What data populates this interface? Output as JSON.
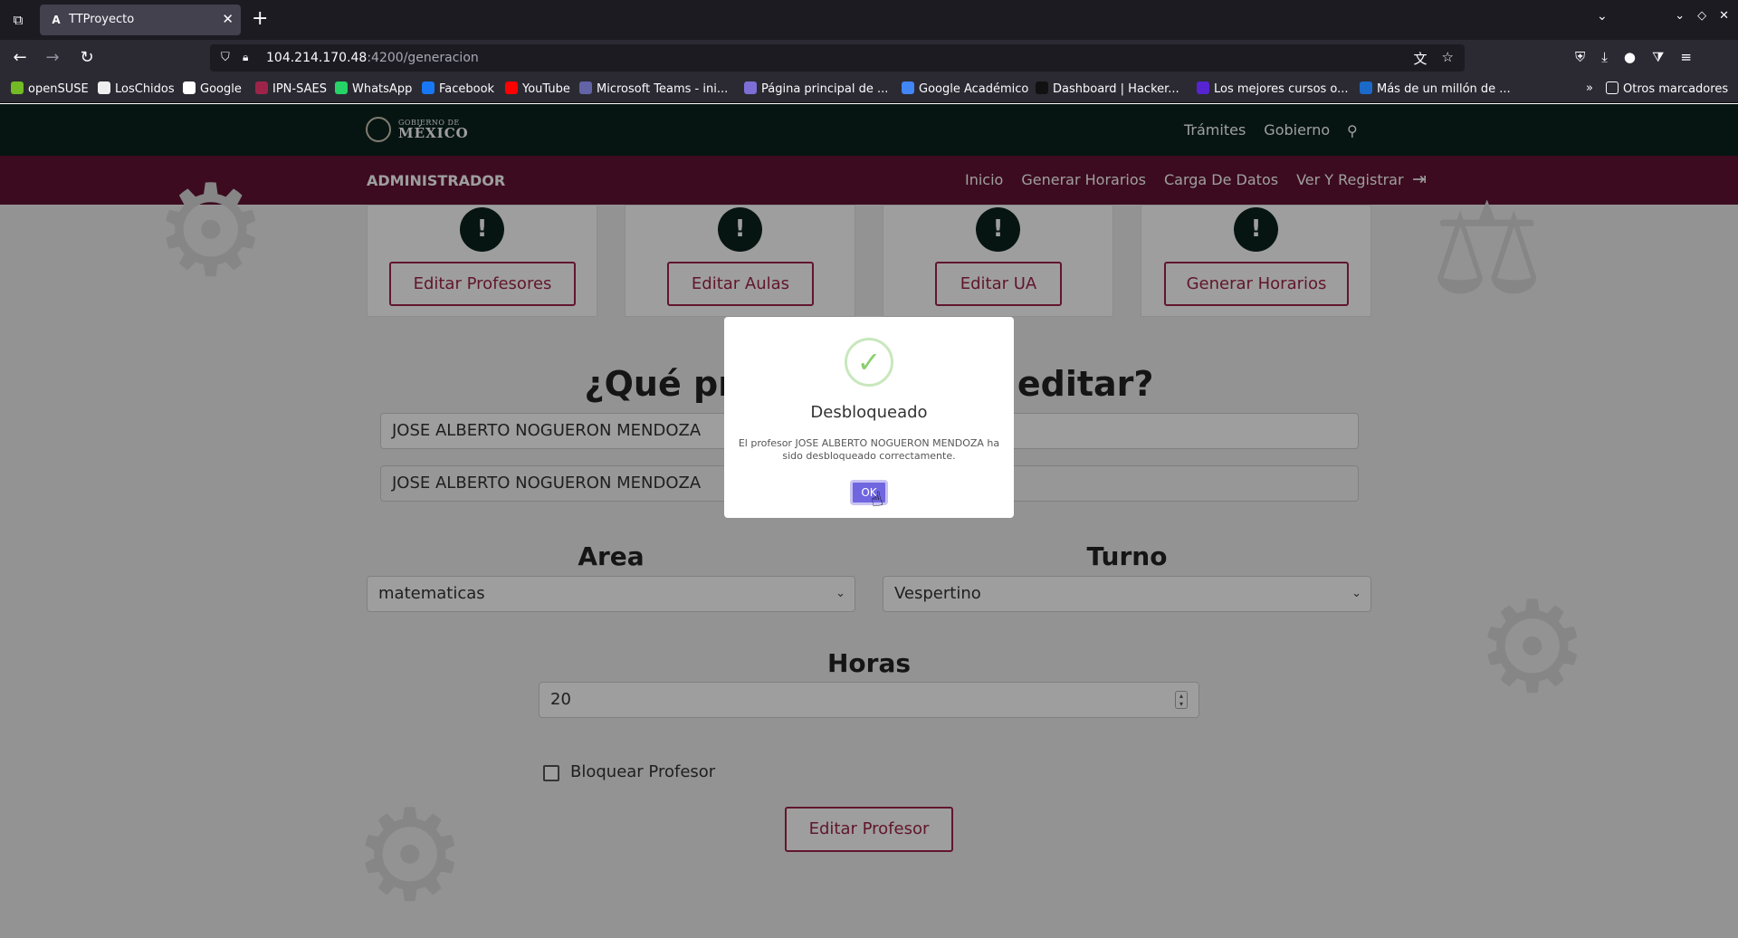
{
  "browser": {
    "tab_title": "TTProyecto",
    "tab_favicon": "A",
    "url_host": "104.214.170.48",
    "url_path": ":4200/generacion",
    "bookmarks": [
      {
        "label": "openSUSE",
        "color": "#73ba25"
      },
      {
        "label": "LosChidos",
        "color": "#eeeeee"
      },
      {
        "label": "Google",
        "color": "#ffffff"
      },
      {
        "label": "IPN-SAES",
        "color": "#9d2449"
      },
      {
        "label": "WhatsApp",
        "color": "#25d366"
      },
      {
        "label": "Facebook",
        "color": "#1877f2"
      },
      {
        "label": "YouTube",
        "color": "#ff0000"
      },
      {
        "label": "Microsoft Teams - ini...",
        "color": "#6264a7"
      },
      {
        "label": "Página principal de ...",
        "color": "#7b6fd6"
      },
      {
        "label": "Google Académico",
        "color": "#4285f4"
      },
      {
        "label": "Dashboard | Hacker...",
        "color": "#111111"
      },
      {
        "label": "Los mejores cursos o...",
        "color": "#5624d0"
      },
      {
        "label": "Más de un millón de ...",
        "color": "#1b6ac9"
      }
    ],
    "other_bookmarks": "Otros marcadores"
  },
  "gov_header": {
    "logo_line1": "GOBIERNO DE",
    "logo_line2": "MÉXICO",
    "links": [
      "Trámites",
      "Gobierno"
    ]
  },
  "admin_bar": {
    "title": "ADMINISTRADOR",
    "links": [
      "Inicio",
      "Generar Horarios",
      "Carga De Datos",
      "Ver Y Registrar"
    ]
  },
  "cards": [
    "Editar Profesores",
    "Editar Aulas",
    "Editar UA",
    "Generar Horarios"
  ],
  "form": {
    "heading": "¿Qué profesor deseas editar?",
    "search_value": "JOSE ALBERTO NOGUERON MENDOZA",
    "name_value": "JOSE ALBERTO NOGUERON MENDOZA",
    "area_label": "Area",
    "area_value": "matematicas",
    "turno_label": "Turno",
    "turno_value": "Vespertino",
    "horas_label": "Horas",
    "horas_value": "20",
    "checkbox_label": "Bloquear Profesor",
    "submit_label": "Editar Profesor"
  },
  "modal": {
    "title": "Desbloqueado",
    "text": "El profesor JOSE ALBERTO NOGUERON MENDOZA ha sido desbloqueado correctamente.",
    "ok_label": "OK",
    "icon_color": "#8ccf6f",
    "button_color": "#7066e0"
  },
  "colors": {
    "gov_dark": "#0c231e",
    "gov_wine": "#611232",
    "accent": "#9d2449"
  }
}
